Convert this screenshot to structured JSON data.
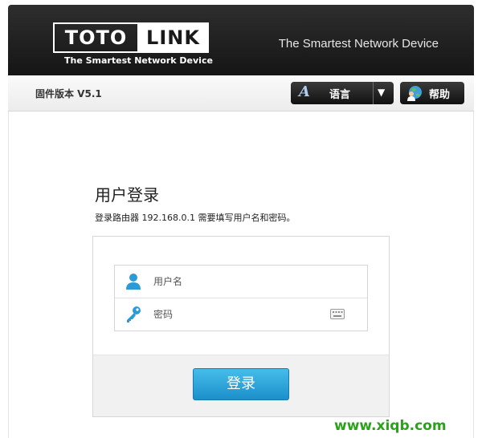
{
  "header": {
    "logo_left": "TOTO",
    "logo_right": "LINK",
    "logo_tagline": "The Smartest Network Device",
    "slogan": "The Smartest Network Device"
  },
  "toolbar": {
    "firmware_version": "固件版本 V5.1",
    "language_icon_glyph": "A",
    "language_label": "语言",
    "language_caret": "▼",
    "help_label": "帮助"
  },
  "login": {
    "title": "用户登录",
    "description": "登录路由器 192.168.0.1 需要填写用户名和密码。",
    "username_placeholder": "用户名",
    "password_placeholder": "密码",
    "submit_label": "登录"
  },
  "icons": {
    "language": "language-icon",
    "help": "globe-user-icon",
    "username": "user-icon",
    "password": "key-icon",
    "keyboard": "keyboard-icon"
  },
  "colors": {
    "header_bg": "#1f1f1f",
    "accent_blue": "#2a9bd6",
    "login_button": "#2aa5dd"
  },
  "watermark": "www.xiqb.com"
}
